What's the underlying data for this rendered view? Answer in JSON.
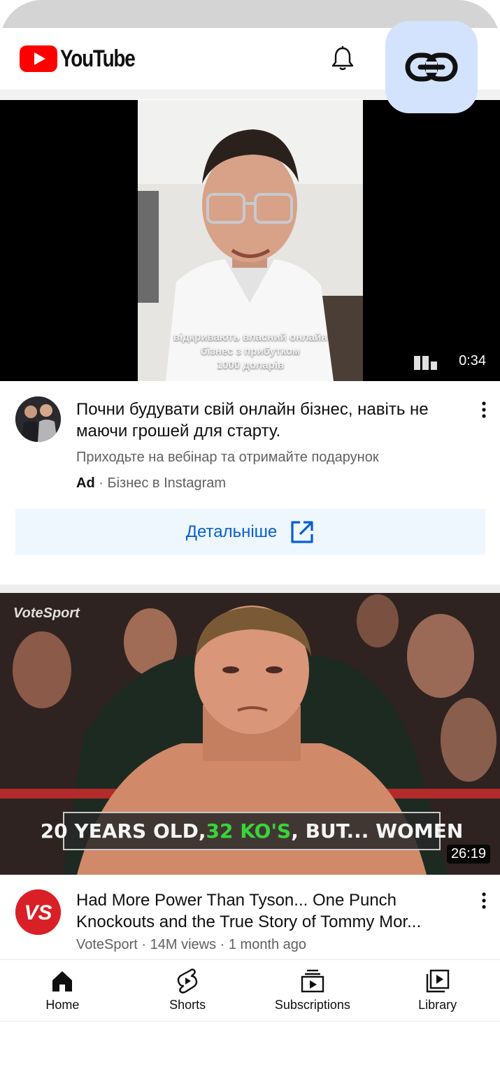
{
  "app": {
    "name": "YouTube",
    "accent": "#ff0000",
    "link_color": "#065fd4"
  },
  "header": {
    "logo_text": "YouTube",
    "icons": [
      "youtube-logo-icon",
      "bell-icon",
      "link-icon"
    ]
  },
  "ad": {
    "caption_lines": [
      "відкривають власний онлайн",
      "бізнес з прибутком",
      "1000 доларів"
    ],
    "duration": "0:34",
    "title": "Почни будувати свій онлайн бізнес, навіть не маючи грошей для старту.",
    "description": "Приходьте на вебінар та отримайте подарунок",
    "badge": "Ad",
    "separator": "·",
    "advertiser": "Бізнес в Instagram",
    "cta_label": "Детальніше"
  },
  "video": {
    "brand_watermark": "VoteSport",
    "banner_prefix": "20 YEARS OLD, ",
    "banner_highlight": "32 KO'S",
    "banner_suffix": ", BUT... WOMEN",
    "duration": "26:19",
    "title_line1": "Had More Power Than Tyson... One Punch",
    "title_line2": "Knockouts and the True Story of Tommy Mor...",
    "meta": "VoteSport · 14M views · 1 month ago",
    "channel_avatar_text": "VS"
  },
  "nav": {
    "items": [
      {
        "label": "Home",
        "icon": "home-icon"
      },
      {
        "label": "Shorts",
        "icon": "shorts-icon"
      },
      {
        "label": "Subscriptions",
        "icon": "subscriptions-icon"
      },
      {
        "label": "Library",
        "icon": "library-icon"
      }
    ]
  }
}
